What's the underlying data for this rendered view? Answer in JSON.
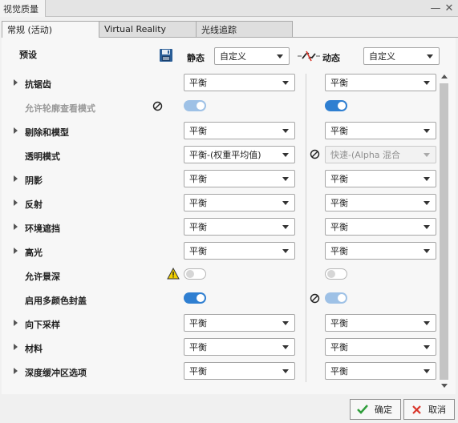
{
  "window": {
    "title": "视觉质量"
  },
  "tabs": [
    {
      "label": "常规 (活动)",
      "active": true
    },
    {
      "label": "Virtual Reality",
      "active": false
    },
    {
      "label": "光线追踪",
      "active": false
    }
  ],
  "header": {
    "preset_label": "预设",
    "static_label": "静态",
    "static_value": "自定义",
    "dynamic_label": "动态",
    "dynamic_value": "自定义"
  },
  "rows": [
    {
      "label": "抗锯齿",
      "static": "平衡",
      "dynamic": "平衡"
    },
    {
      "label": "允许轮廓查看模式",
      "static_toggle": "on-disabled",
      "dynamic_toggle": "on"
    },
    {
      "label": "剔除和模型",
      "static": "平衡",
      "dynamic": "平衡"
    },
    {
      "label": "透明模式",
      "static": "平衡-(权重平均值)",
      "dynamic": "快速-(Alpha 混合"
    },
    {
      "label": "阴影",
      "static": "平衡",
      "dynamic": "平衡"
    },
    {
      "label": "反射",
      "static": "平衡",
      "dynamic": "平衡"
    },
    {
      "label": "环境遮挡",
      "static": "平衡",
      "dynamic": "平衡"
    },
    {
      "label": "高光",
      "static": "平衡",
      "dynamic": "平衡"
    },
    {
      "label": "允许景深",
      "static_toggle": "off",
      "dynamic_toggle": "off"
    },
    {
      "label": "启用多颜色封盖",
      "static_toggle": "on",
      "dynamic_toggle": "on-disabled"
    },
    {
      "label": "向下采样",
      "static": "平衡",
      "dynamic": "平衡"
    },
    {
      "label": "材料",
      "static": "平衡",
      "dynamic": "平衡"
    },
    {
      "label": "深度缓冲区选项",
      "static": "平衡",
      "dynamic": "平衡"
    }
  ],
  "buttons": {
    "ok": "确定",
    "cancel": "取消"
  },
  "colors": {
    "accent": "#2f7fd1",
    "ok_check": "#2e9d3a",
    "cancel_x": "#d9362b",
    "warning": "#f2d000"
  }
}
